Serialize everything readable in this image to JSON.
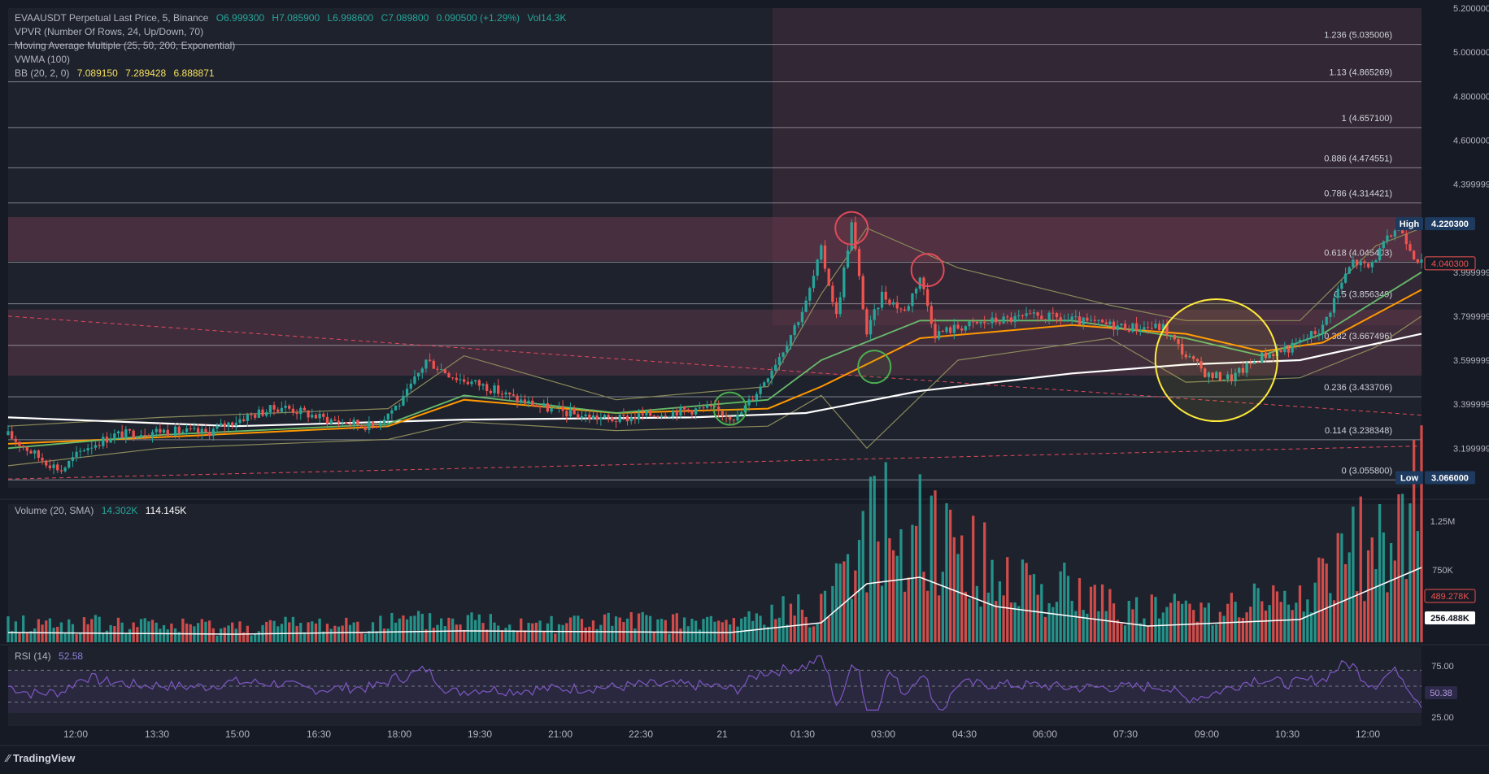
{
  "header": {
    "symbol_line": "EVAAUSDT Perpetual Last Price, 5, Binance",
    "open": "O6.999300",
    "high": "H7.085900",
    "low": "L6.998600",
    "close": "C7.089800",
    "change": "0.090500 (+1.29%)",
    "vol": "Vol14.3K",
    "indicators": [
      "VPVR (Number Of Rows, 24, Up/Down, 70)",
      "Moving Average Multiple (25, 50, 200, Exponential)",
      "VWMA (100)"
    ],
    "bb_label": "BB (20, 2, 0)",
    "bb_values": [
      "7.089150",
      "7.289428",
      "6.888871"
    ]
  },
  "volume_legend": {
    "label": "Volume (20, SMA)",
    "v1": "14.302K",
    "v2": "114.145K"
  },
  "rsi_legend": {
    "label": "RSI (14)",
    "value": "52.58"
  },
  "footer": {
    "brand": "TradingView"
  },
  "colors": {
    "background": "#161a25",
    "pane": "#1e222d",
    "up": "#26a69a",
    "down": "#ef5350",
    "ema25": "#66bb6a",
    "ema50": "#ff9800",
    "ema200": "#ffffff",
    "bb": "#8a8a5a",
    "circle_red": "#e04a5a",
    "circle_green": "#4caf50",
    "circle_yellow": "#ffeb3b",
    "rsi": "#7e57c2"
  },
  "chart_data": [
    {
      "type": "candlestick",
      "title": "EVAAUSDT Perpetual Last Price, 5, Binance",
      "x_ticks": [
        "12:00",
        "13:30",
        "15:00",
        "16:30",
        "18:00",
        "19:30",
        "21:00",
        "22:30",
        "21",
        "01:30",
        "03:00",
        "04:30",
        "06:00",
        "07:30",
        "09:00",
        "10:30",
        "12:00"
      ],
      "y_ticks": [
        "5.200000",
        "5.000000",
        "4.800000",
        "4.600000",
        "4.399999",
        "3.999999",
        "3.799999",
        "3.599999",
        "3.399999",
        "3.199999"
      ],
      "ylim": [
        3.02,
        5.2
      ],
      "fib_levels": [
        {
          "label": "1.236 (5.035006)",
          "value": 5.035006
        },
        {
          "label": "1.13 (4.865269)",
          "value": 4.865269
        },
        {
          "label": "1 (4.657100)",
          "value": 4.6571
        },
        {
          "label": "0.886 (4.474551)",
          "value": 4.474551
        },
        {
          "label": "0.786 (4.314421)",
          "value": 4.314421
        },
        {
          "label": "0.618 (4.045403)",
          "value": 4.045403
        },
        {
          "label": "0.5 (3.856349)",
          "value": 3.856349
        },
        {
          "label": "0.382 (3.667496)",
          "value": 3.667496
        },
        {
          "label": "0.236 (3.433706)",
          "value": 3.433706
        },
        {
          "label": "0.114 (3.238348)",
          "value": 3.238348
        },
        {
          "label": "0 (3.055800)",
          "value": 3.0558
        }
      ],
      "high": {
        "label": "High",
        "value": "4.220300"
      },
      "low": {
        "label": "Low",
        "value": "3.066000"
      },
      "last_price": "4.040300",
      "price_path": [
        [
          0,
          3.26
        ],
        [
          8,
          3.16
        ],
        [
          14,
          3.1
        ],
        [
          20,
          3.2
        ],
        [
          28,
          3.26
        ],
        [
          40,
          3.28
        ],
        [
          52,
          3.27
        ],
        [
          62,
          3.34
        ],
        [
          72,
          3.39
        ],
        [
          84,
          3.33
        ],
        [
          96,
          3.3
        ],
        [
          104,
          3.42
        ],
        [
          110,
          3.6
        ],
        [
          118,
          3.52
        ],
        [
          126,
          3.48
        ],
        [
          134,
          3.42
        ],
        [
          142,
          3.38
        ],
        [
          150,
          3.35
        ],
        [
          160,
          3.33
        ],
        [
          168,
          3.35
        ],
        [
          176,
          3.37
        ],
        [
          184,
          3.38
        ],
        [
          192,
          3.34
        ],
        [
          198,
          3.48
        ],
        [
          204,
          3.65
        ],
        [
          210,
          3.86
        ],
        [
          214,
          4.1
        ],
        [
          218,
          3.8
        ],
        [
          222,
          4.22
        ],
        [
          226,
          3.72
        ],
        [
          230,
          3.9
        ],
        [
          236,
          3.82
        ],
        [
          240,
          3.98
        ],
        [
          244,
          3.72
        ],
        [
          250,
          3.75
        ],
        [
          260,
          3.78
        ],
        [
          272,
          3.8
        ],
        [
          284,
          3.77
        ],
        [
          296,
          3.75
        ],
        [
          304,
          3.75
        ],
        [
          310,
          3.62
        ],
        [
          316,
          3.53
        ],
        [
          322,
          3.52
        ],
        [
          330,
          3.62
        ],
        [
          338,
          3.66
        ],
        [
          346,
          3.75
        ],
        [
          350,
          3.92
        ],
        [
          354,
          4.05
        ],
        [
          358,
          4.02
        ],
        [
          362,
          4.12
        ],
        [
          366,
          4.22
        ],
        [
          370,
          4.08
        ],
        [
          372,
          4.04
        ]
      ],
      "ema25": [
        [
          0,
          3.2
        ],
        [
          40,
          3.26
        ],
        [
          100,
          3.31
        ],
        [
          120,
          3.44
        ],
        [
          160,
          3.36
        ],
        [
          200,
          3.42
        ],
        [
          214,
          3.6
        ],
        [
          240,
          3.78
        ],
        [
          280,
          3.78
        ],
        [
          310,
          3.7
        ],
        [
          330,
          3.62
        ],
        [
          346,
          3.72
        ],
        [
          372,
          4.0
        ]
      ],
      "ema50": [
        [
          0,
          3.22
        ],
        [
          40,
          3.25
        ],
        [
          100,
          3.3
        ],
        [
          120,
          3.42
        ],
        [
          160,
          3.36
        ],
        [
          200,
          3.38
        ],
        [
          214,
          3.48
        ],
        [
          240,
          3.7
        ],
        [
          280,
          3.76
        ],
        [
          310,
          3.72
        ],
        [
          330,
          3.64
        ],
        [
          346,
          3.68
        ],
        [
          372,
          3.92
        ]
      ],
      "ema200": [
        [
          0,
          3.34
        ],
        [
          60,
          3.3
        ],
        [
          120,
          3.33
        ],
        [
          180,
          3.34
        ],
        [
          210,
          3.36
        ],
        [
          240,
          3.46
        ],
        [
          280,
          3.54
        ],
        [
          310,
          3.58
        ],
        [
          340,
          3.6
        ],
        [
          372,
          3.72
        ]
      ],
      "bb_upper": [
        [
          0,
          3.3
        ],
        [
          40,
          3.34
        ],
        [
          100,
          3.38
        ],
        [
          120,
          3.62
        ],
        [
          160,
          3.42
        ],
        [
          200,
          3.48
        ],
        [
          214,
          3.9
        ],
        [
          226,
          4.2
        ],
        [
          250,
          4.02
        ],
        [
          290,
          3.85
        ],
        [
          310,
          3.78
        ],
        [
          340,
          3.78
        ],
        [
          360,
          4.12
        ],
        [
          372,
          4.2
        ]
      ],
      "bb_lower": [
        [
          0,
          3.12
        ],
        [
          40,
          3.2
        ],
        [
          100,
          3.24
        ],
        [
          120,
          3.32
        ],
        [
          160,
          3.28
        ],
        [
          200,
          3.3
        ],
        [
          214,
          3.44
        ],
        [
          226,
          3.2
        ],
        [
          250,
          3.6
        ],
        [
          290,
          3.7
        ],
        [
          310,
          3.5
        ],
        [
          340,
          3.52
        ],
        [
          360,
          3.66
        ],
        [
          372,
          3.8
        ]
      ],
      "dashed_lines": [
        {
          "from": [
            0,
            3.8
          ],
          "to": [
            372,
            3.35
          ]
        },
        {
          "from": [
            0,
            3.06
          ],
          "to": [
            372,
            3.21
          ]
        }
      ],
      "annotations": [
        {
          "shape": "circle",
          "color": "red",
          "at": [
            222,
            4.2
          ]
        },
        {
          "shape": "circle",
          "color": "red",
          "at": [
            242,
            4.01
          ]
        },
        {
          "shape": "circle",
          "color": "green",
          "at": [
            228,
            3.57
          ]
        },
        {
          "shape": "circle",
          "color": "green",
          "at": [
            190,
            3.38
          ]
        },
        {
          "shape": "circle",
          "color": "yellow",
          "at": [
            318,
            3.6
          ]
        }
      ]
    },
    {
      "type": "bar",
      "title": "Volume (20, SMA)",
      "y_ticks": [
        "1.25M",
        "750K"
      ],
      "markers": [
        "489.278K",
        "256.488K"
      ],
      "ma_path": [
        [
          0,
          30
        ],
        [
          60,
          25
        ],
        [
          120,
          35
        ],
        [
          190,
          30
        ],
        [
          214,
          60
        ],
        [
          226,
          180
        ],
        [
          240,
          200
        ],
        [
          260,
          110
        ],
        [
          300,
          50
        ],
        [
          340,
          70
        ],
        [
          372,
          230
        ]
      ]
    },
    {
      "type": "line",
      "title": "RSI (14)",
      "y_ticks": [
        "75.00",
        "25.00"
      ],
      "levels": [
        70,
        50,
        30
      ],
      "current": "50.38"
    }
  ]
}
